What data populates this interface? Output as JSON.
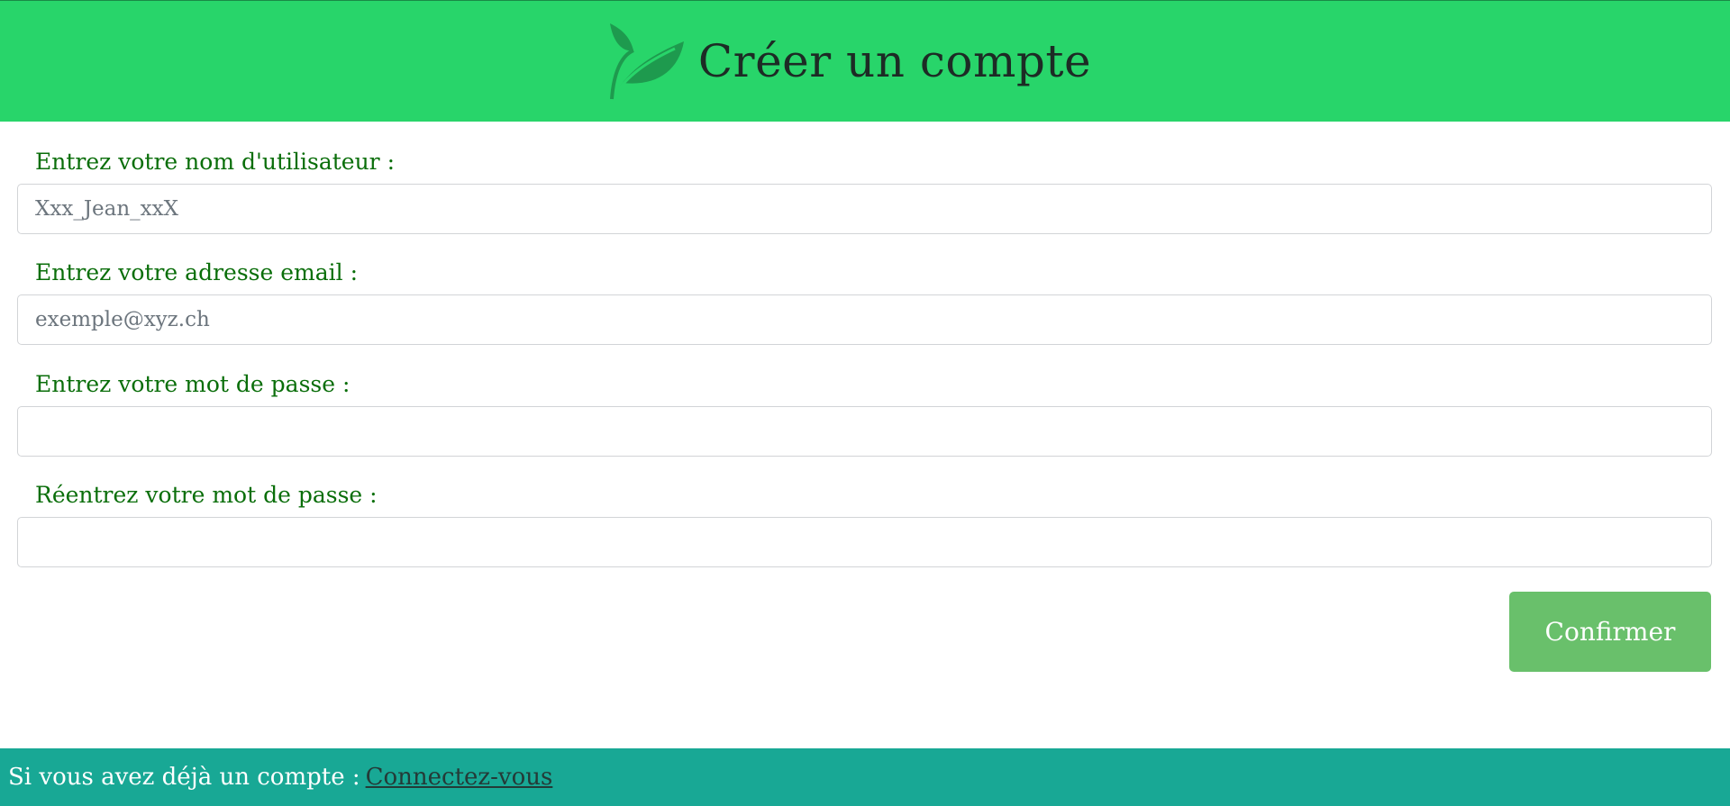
{
  "header": {
    "title": "Créer un compte",
    "icon": "leaf-icon",
    "background_color": "#28d56a"
  },
  "form": {
    "username": {
      "label": "Entrez votre nom d'utilisateur :",
      "placeholder": "Xxx_Jean_xxX",
      "value": ""
    },
    "email": {
      "label": "Entrez votre adresse email :",
      "placeholder": "exemple@xyz.ch",
      "value": ""
    },
    "password": {
      "label": "Entrez votre mot de passe :",
      "value": ""
    },
    "password_confirm": {
      "label": "Réentrez votre mot de passe :",
      "value": ""
    },
    "confirm_label": "Confirmer",
    "label_color": "#0a6e0a",
    "button_color": "#69c06b"
  },
  "footer": {
    "text": "Si vous avez déjà un compte :",
    "link_label": "Connectez-vous",
    "background_color": "#18a895"
  }
}
